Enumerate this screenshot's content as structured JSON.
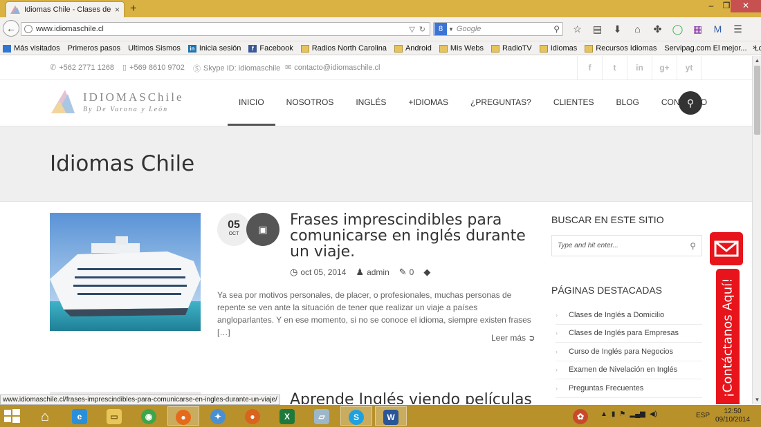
{
  "browser": {
    "tab_title": "Idiomas Chile - Clases de I...",
    "tab_close": "×",
    "new_tab": "+",
    "url": "www.idiomaschile.cl",
    "search_placeholder": "Google",
    "search_engine_icon": "google-engine-icon",
    "window_controls": [
      "–",
      "❐",
      "✕"
    ]
  },
  "bookmarks": [
    {
      "label": "Más visitados",
      "icon": "star"
    },
    {
      "label": "Primeros pasos",
      "icon": "page"
    },
    {
      "label": "Ultimos Sismos",
      "icon": "page"
    },
    {
      "label": "Inicia sesión",
      "icon": "in"
    },
    {
      "label": "Facebook",
      "icon": "fb"
    },
    {
      "label": "Radios North Carolina",
      "icon": "folder"
    },
    {
      "label": "Android",
      "icon": "folder"
    },
    {
      "label": "Mis Webs",
      "icon": "folder"
    },
    {
      "label": "RadioTV",
      "icon": "folder"
    },
    {
      "label": "Idiomas",
      "icon": "folder"
    },
    {
      "label": "Recursos Idiomas",
      "icon": "folder"
    },
    {
      "label": "Servipag.com El mejor...",
      "icon": "page"
    },
    {
      "label": "Los mejores artículos s...",
      "icon": "page"
    }
  ],
  "bookmarks_more": "»",
  "topbar": {
    "phone": "+562 2771 1268",
    "mobile": "+569 8610 9702",
    "skype": "Skype ID: idiomaschile",
    "email": "contacto@idiomaschile.cl",
    "social": [
      "f",
      "t",
      "in",
      "g+",
      "yt"
    ]
  },
  "logo": {
    "title": "IDIOMASChile",
    "subtitle": "By De Varona y León"
  },
  "menu": [
    "INICIO",
    "NOSOTROS",
    "INGLÉS",
    "+IDIOMAS",
    "¿PREGUNTAS?",
    "CLIENTES",
    "BLOG",
    "CONTACTO"
  ],
  "banner_title": "Idiomas Chile",
  "post": {
    "day": "05",
    "month": "OCT",
    "title": "Frases imprescindibles para comunicarse en inglés durante un viaje.",
    "date": "oct 05, 2014",
    "author": "admin",
    "comments": "0",
    "excerpt": "Ya sea por motivos personales, de placer, o profesionales, muchas personas de repente se ven ante la situación de tener que realizar un viaje a países angloparlantes. Y en ese momento, si no se conoce el idioma, siempre existen frases […]",
    "read_more": "Leer más"
  },
  "post2_title": "Aprende Inglés viendo películas",
  "sidebar": {
    "search_title": "BUSCAR EN ESTE SITIO",
    "search_placeholder": "Type and hit enter...",
    "pages_title": "PÁGINAS DESTACADAS",
    "pages": [
      "Clases de Inglés a Domicilio",
      "Clases de Inglés para Empresas",
      "Curso de Inglés para Negocios",
      "Examen de Nivelación en Inglés",
      "Preguntas Frecuentes"
    ]
  },
  "contact_tab": "¡Contáctanos Aquí!",
  "status_url": "www.idiomaschile.cl/frases-imprescindibles-para-comunicarse-en-ingles-durante-un-viaje/",
  "taskbar": {
    "lang": "ESP",
    "time": "12:50",
    "date": "09/10/2014"
  },
  "colors": {
    "accent_red": "#e8141b",
    "taskbar": "#b8912a",
    "titlebar": "#d9b243"
  }
}
